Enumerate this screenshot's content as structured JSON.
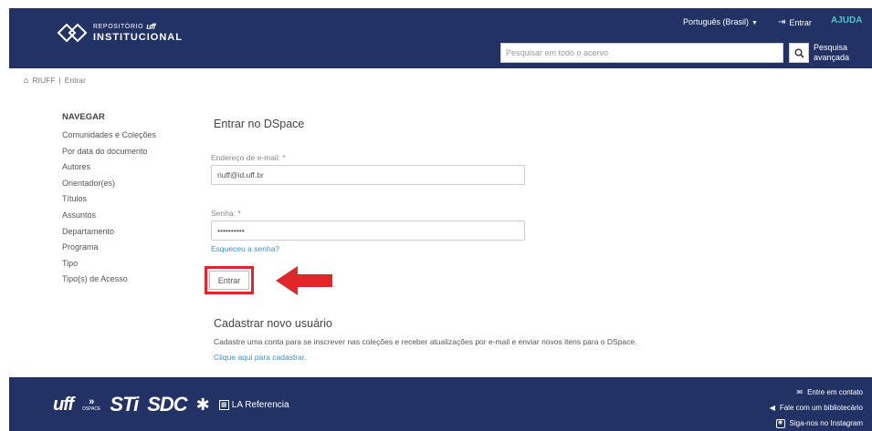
{
  "header": {
    "logo_line1": "REPOSITÓRIO",
    "logo_brand": "uff",
    "logo_line2": "INSTITUCIONAL",
    "language": "Português (Brasil)",
    "login": "Entrar",
    "help": "AJUDA",
    "search_placeholder": "Pesquisar em todo o acervo",
    "advanced_search": "Pesquisa avançada"
  },
  "breadcrumb": {
    "home": "RIUFF",
    "separator": "|",
    "current": "Entrar"
  },
  "sidebar": {
    "title": "NAVEGAR",
    "items": [
      "Comunidades e Coleções",
      "Por data do documento",
      "Autores",
      "Orientador(es)",
      "Títulos",
      "Assuntos",
      "Departamento",
      "Programa",
      "Tipo",
      "Tipo(s) de Acesso"
    ]
  },
  "login_form": {
    "title": "Entrar no DSpace",
    "email_label": "Endereço de e-mail: *",
    "email_value": "riuff@id.uff.br",
    "password_label": "Senha: *",
    "password_value": "••••••••••",
    "forgot": "Esqueceu a senha?",
    "submit": "Entrar"
  },
  "register": {
    "title": "Cadastrar novo usuário",
    "text": "Cadastre uma conta para se inscrever nas coleções e receber atualizações por e-mail e enviar novos itens para o DSpace.",
    "link": "Clique aqui para cadastrar."
  },
  "footer": {
    "logo_uff": "uff",
    "logo_dspace": "DSPACE",
    "logo_sti": "STi",
    "logo_sdc": "SDC",
    "logo_la": "LA Referencia",
    "contact": "Entre em contato",
    "librarian": "Fale com um bibliotecário",
    "instagram": "Siga-nos no Instagram"
  },
  "colors": {
    "brand_navy": "#233264",
    "help_teal": "#4ec4c0",
    "link_blue": "#3b8fbf",
    "highlight_red": "#e0262b"
  }
}
